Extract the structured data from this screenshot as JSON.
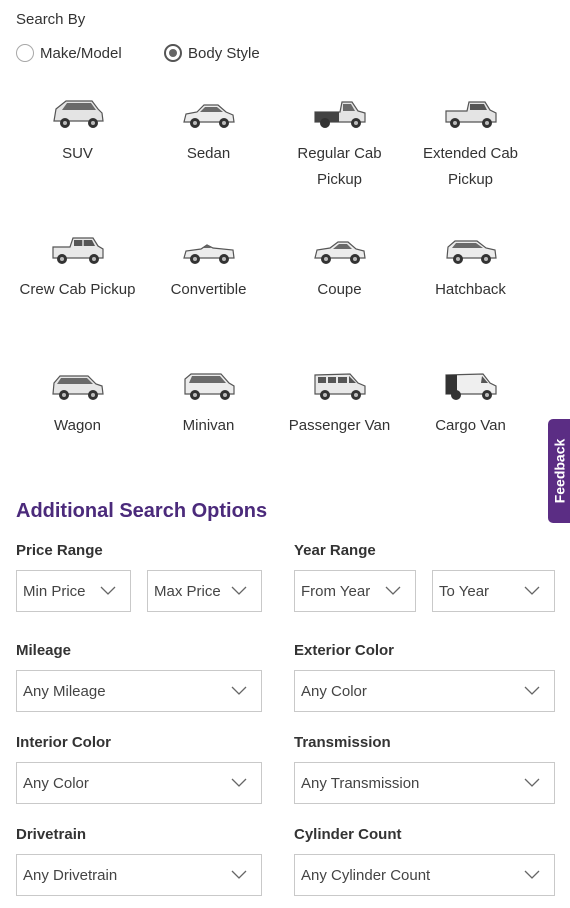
{
  "search_by": {
    "label": "Search By",
    "options": [
      {
        "label": "Make/Model",
        "selected": false
      },
      {
        "label": "Body Style",
        "selected": true
      }
    ]
  },
  "body_styles": [
    {
      "label": "SUV",
      "icon": "suv-icon"
    },
    {
      "label": "Sedan",
      "icon": "sedan-icon"
    },
    {
      "label": "Regular Cab Pickup",
      "icon": "regular-cab-pickup-icon"
    },
    {
      "label": "Extended Cab Pickup",
      "icon": "extended-cab-pickup-icon"
    },
    {
      "label": "Crew Cab Pickup",
      "icon": "crew-cab-pickup-icon"
    },
    {
      "label": "Convertible",
      "icon": "convertible-icon"
    },
    {
      "label": "Coupe",
      "icon": "coupe-icon"
    },
    {
      "label": "Hatchback",
      "icon": "hatchback-icon"
    },
    {
      "label": "Wagon",
      "icon": "wagon-icon"
    },
    {
      "label": "Minivan",
      "icon": "minivan-icon"
    },
    {
      "label": "Passenger Van",
      "icon": "passenger-van-icon"
    },
    {
      "label": "Cargo Van",
      "icon": "cargo-van-icon"
    }
  ],
  "feedback": {
    "label": "Feedback",
    "color": "#5b2d84"
  },
  "additional": {
    "title": "Additional Search Options",
    "title_color": "#4b2a7b",
    "price_range": {
      "label": "Price Range",
      "min": "Min Price",
      "max": "Max Price"
    },
    "year_range": {
      "label": "Year Range",
      "from": "From Year",
      "to": "To Year"
    },
    "mileage": {
      "label": "Mileage",
      "value": "Any Mileage"
    },
    "exterior_color": {
      "label": "Exterior Color",
      "value": "Any Color"
    },
    "interior_color": {
      "label": "Interior Color",
      "value": "Any Color"
    },
    "transmission": {
      "label": "Transmission",
      "value": "Any Transmission"
    },
    "drivetrain": {
      "label": "Drivetrain",
      "value": "Any Drivetrain"
    },
    "cylinder_count": {
      "label": "Cylinder Count",
      "value": "Any Cylinder Count"
    }
  }
}
